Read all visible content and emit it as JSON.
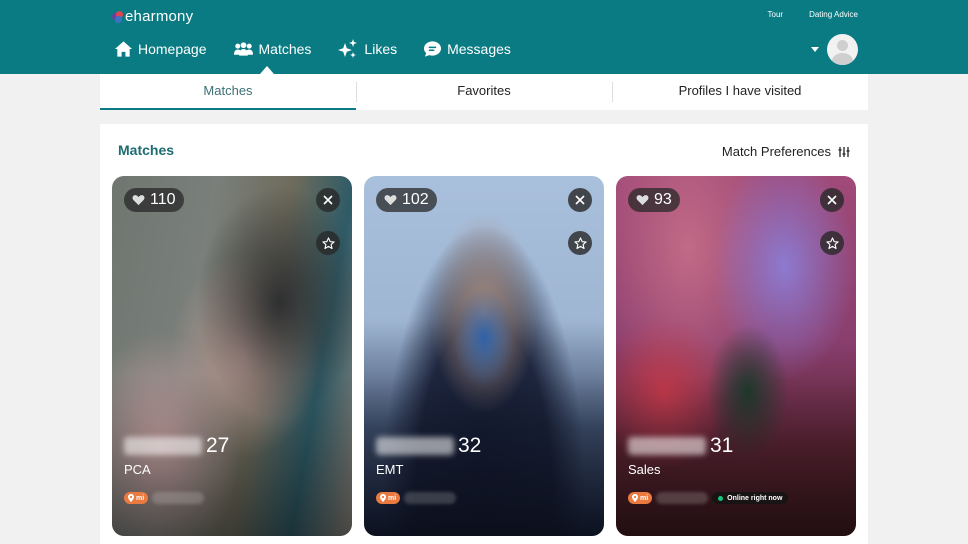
{
  "brand": {
    "name": "eharmony",
    "color": "#0a7b83"
  },
  "header": {
    "top_links": [
      "Tour",
      "Dating Advice"
    ],
    "nav": [
      {
        "label": "Homepage",
        "icon": "home-icon"
      },
      {
        "label": "Matches",
        "icon": "people-icon",
        "active": true
      },
      {
        "label": "Likes",
        "icon": "sparkle-icon"
      },
      {
        "label": "Messages",
        "icon": "chat-icon"
      }
    ]
  },
  "tabs": [
    {
      "label": "Matches",
      "active": true
    },
    {
      "label": "Favorites"
    },
    {
      "label": "Profiles I have visited"
    }
  ],
  "section": {
    "title": "Matches",
    "preferences_label": "Match Preferences"
  },
  "cards": [
    {
      "likes": "110",
      "age": "27",
      "occupation": "PCA",
      "distance_unit": "mi",
      "online": false
    },
    {
      "likes": "102",
      "age": "32",
      "occupation": "EMT",
      "distance_unit": "mi",
      "online": false
    },
    {
      "likes": "93",
      "age": "31",
      "occupation": "Sales",
      "distance_unit": "mi",
      "online": true,
      "online_label": "Online right now"
    }
  ]
}
